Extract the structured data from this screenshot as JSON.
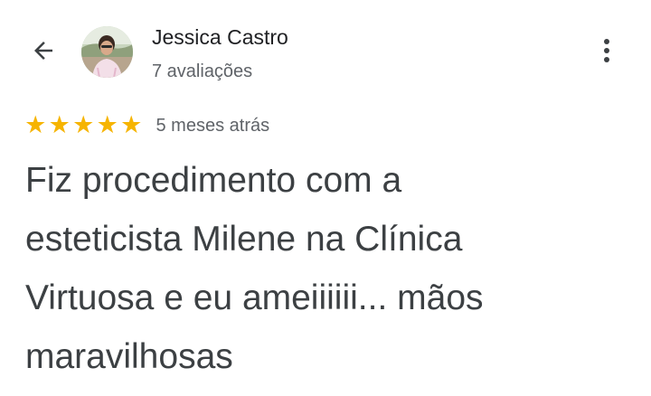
{
  "header": {
    "back_icon": "arrow-left-icon",
    "author_name": "Jessica Castro",
    "review_count": "7 avaliações",
    "more_icon": "more-vertical-icon"
  },
  "review": {
    "rating": 5,
    "max_rating": 5,
    "star_color": "#f6b400",
    "time_ago": "5 meses atrás",
    "text_lines": [
      "Fiz procedimento com a",
      "esteticista Milene na Clínica",
      "Virtuosa e eu ameiiiiii... mãos",
      "maravilhosas"
    ]
  }
}
